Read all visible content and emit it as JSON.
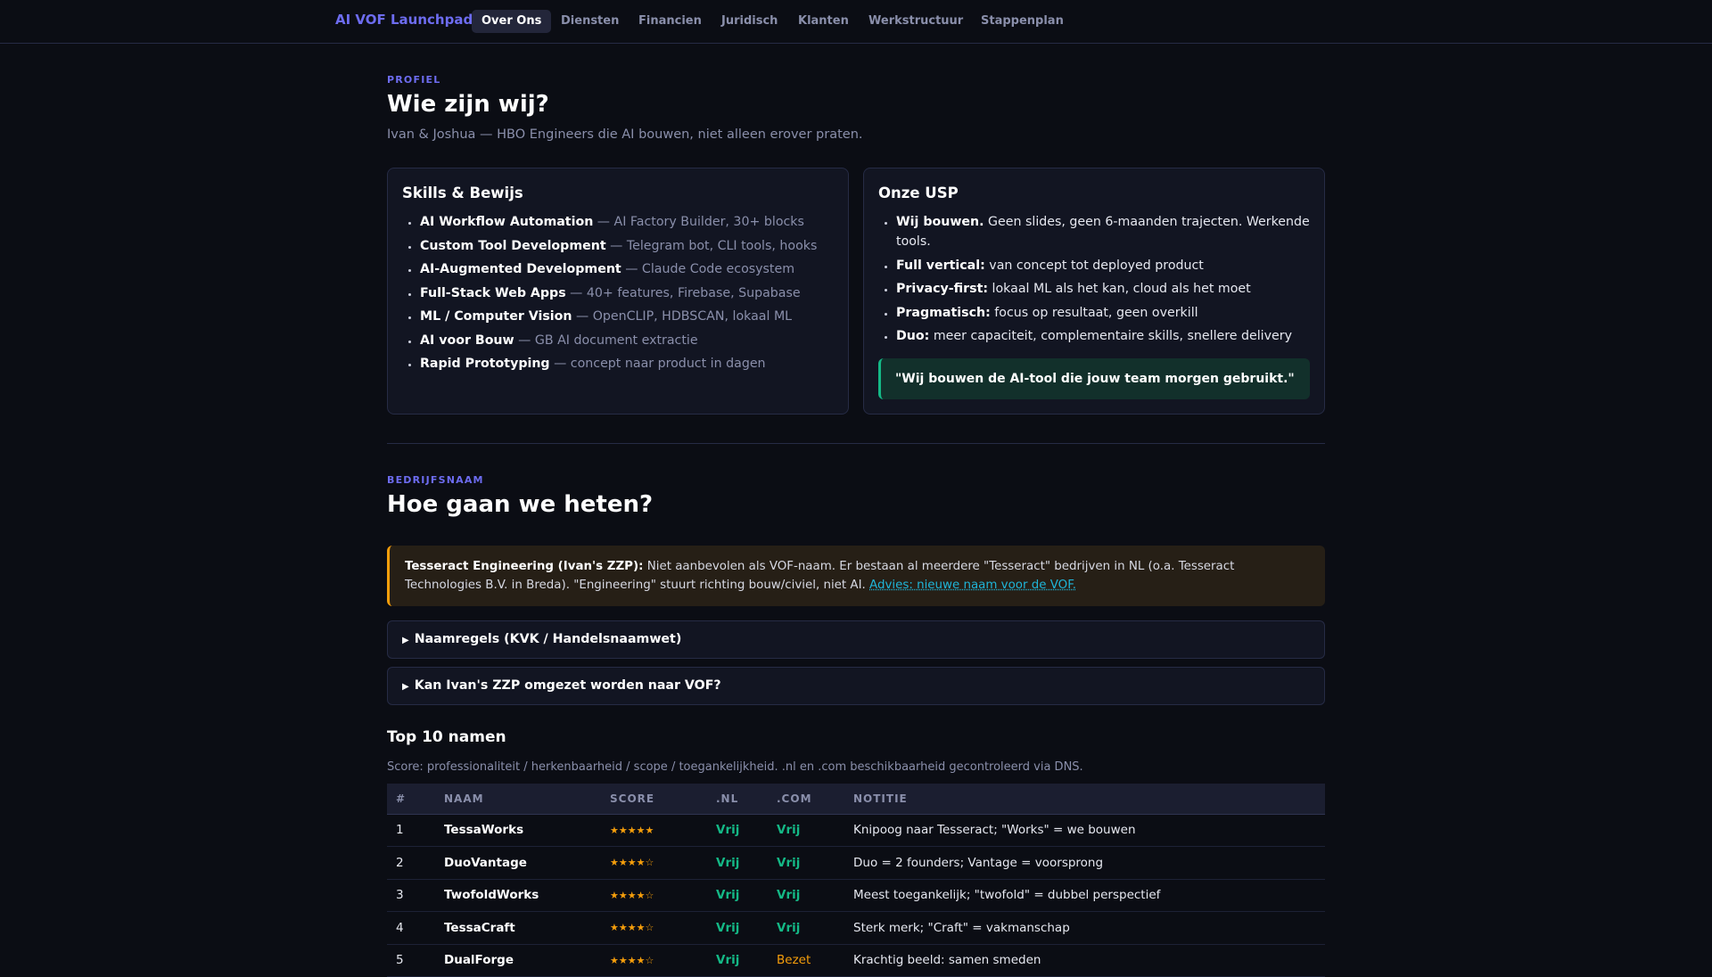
{
  "nav": {
    "logo": "AI VOF Launchpad",
    "tabs": [
      {
        "label": "Over Ons",
        "active": true
      },
      {
        "label": "Diensten"
      },
      {
        "label": "Financien"
      },
      {
        "label": "Juridisch"
      },
      {
        "label": "Klanten"
      },
      {
        "label": "Werkstructuur"
      },
      {
        "label": "Stappenplan"
      }
    ]
  },
  "profiel": {
    "eyebrow": "PROFIEL",
    "title": "Wie zijn wij?",
    "subtitle": "Ivan & Joshua — HBO Engineers die AI bouwen, niet alleen erover praten.",
    "skills": {
      "title": "Skills & Bewijs",
      "items": [
        {
          "name": "AI Workflow Automation",
          "desc": " — AI Factory Builder, 30+ blocks"
        },
        {
          "name": "Custom Tool Development",
          "desc": " — Telegram bot, CLI tools, hooks"
        },
        {
          "name": "AI-Augmented Development",
          "desc": " — Claude Code ecosystem"
        },
        {
          "name": "Full-Stack Web Apps",
          "desc": " — 40+ features, Firebase, Supabase"
        },
        {
          "name": "ML / Computer Vision",
          "desc": " — OpenCLIP, HDBSCAN, lokaal ML"
        },
        {
          "name": "AI voor Bouw",
          "desc": " — GB AI document extractie"
        },
        {
          "name": "Rapid Prototyping",
          "desc": " — concept naar product in dagen"
        }
      ]
    },
    "usp": {
      "title": "Onze USP",
      "items": [
        {
          "name": "Wij bouwen.",
          "desc": " Geen slides, geen 6-maanden trajecten. Werkende tools."
        },
        {
          "name": "Full vertical:",
          "desc": " van concept tot deployed product"
        },
        {
          "name": "Privacy-first:",
          "desc": " lokaal ML als het kan, cloud als het moet"
        },
        {
          "name": "Pragmatisch:",
          "desc": " focus op resultaat, geen overkill"
        },
        {
          "name": "Duo:",
          "desc": " meer capaciteit, complementaire skills, snellere delivery"
        }
      ],
      "quote": "\"Wij bouwen de AI-tool die jouw team morgen gebruikt.\""
    }
  },
  "naam": {
    "eyebrow": "BEDRIJFSNAAM",
    "title": "Hoe gaan we heten?",
    "warning": {
      "bold": "Tesseract Engineering (Ivan's ZZP):",
      "text": " Niet aanbevolen als VOF-naam. Er bestaan al meerdere \"Tesseract\" bedrijven in NL (o.a. Tesseract Technologies B.V. in Breda). \"Engineering\" stuurt richting bouw/civiel, niet AI. ",
      "link": "Advies: nieuwe naam voor de VOF."
    },
    "details": [
      {
        "summary": "Naamregels (KVK / Handelsnaamwet)"
      },
      {
        "summary": "Kan Ivan's ZZP omgezet worden naar VOF?"
      }
    ],
    "top10": {
      "title": "Top 10 namen",
      "caption": "Score: professionaliteit / herkenbaarheid / scope / toegankelijkheid. .nl en .com beschikbaarheid gecontroleerd via DNS.",
      "headers": [
        "#",
        "NAAM",
        "SCORE",
        ".NL",
        ".COM",
        "NOTITIE"
      ],
      "rows": [
        {
          "n": "1",
          "name": "TessaWorks",
          "score": "★★★★★",
          "nl": "Vrij",
          "com": "Vrij",
          "note": "Knipoog naar Tesseract; \"Works\" = we bouwen"
        },
        {
          "n": "2",
          "name": "DuoVantage",
          "score": "★★★★☆",
          "nl": "Vrij",
          "com": "Vrij",
          "note": "Duo = 2 founders; Vantage = voorsprong"
        },
        {
          "n": "3",
          "name": "TwofoldWorks",
          "score": "★★★★☆",
          "nl": "Vrij",
          "com": "Vrij",
          "note": "Meest toegankelijk; \"twofold\" = dubbel perspectief"
        },
        {
          "n": "4",
          "name": "TessaCraft",
          "score": "★★★★☆",
          "nl": "Vrij",
          "com": "Vrij",
          "note": "Sterk merk; \"Craft\" = vakmanschap"
        },
        {
          "n": "5",
          "name": "DualForge",
          "score": "★★★★☆",
          "nl": "Vrij",
          "com": "Bezet",
          "note": "Krachtig beeld: samen smeden"
        }
      ]
    }
  }
}
